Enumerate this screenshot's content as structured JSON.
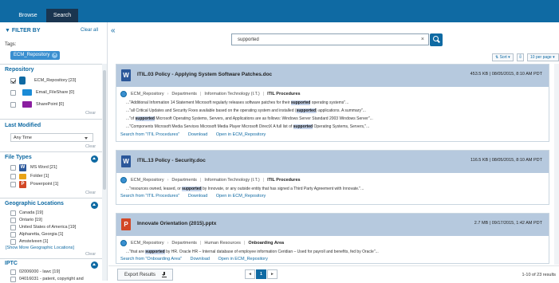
{
  "tabs": [
    {
      "label": "Browse"
    },
    {
      "label": "Search"
    }
  ],
  "sidebar": {
    "filter_by": "FILTER BY",
    "clear_all": "Clear all",
    "tags_label": "Tags:",
    "tag": "ECM_Repository",
    "repository": {
      "title": "Repository",
      "items": [
        {
          "label": "ECM_Repository [23]",
          "checked": true,
          "color": "#0f6aa3"
        },
        {
          "label": "Email_FileShare [0]",
          "checked": false,
          "color": "#1a8bd6"
        },
        {
          "label": "SharePoint [0]",
          "checked": false,
          "color": "#8b1ea0"
        }
      ],
      "clear": "Clear"
    },
    "last_modified": {
      "title": "Last Modified",
      "value": "Any Time",
      "clear": "Clear"
    },
    "file_types": {
      "title": "File Types",
      "items": [
        {
          "label": "MS Word [21]",
          "color": "#2b579a",
          "glyph": "W"
        },
        {
          "label": "Folder [1]",
          "color": "#e8a318",
          "glyph": ""
        },
        {
          "label": "Powerpoint [1]",
          "color": "#d24726",
          "glyph": "P"
        }
      ],
      "clear": "Clear"
    },
    "geo": {
      "title": "Geographic Locations",
      "items": [
        {
          "label": "Canada [19]"
        },
        {
          "label": "Ontario [19]"
        },
        {
          "label": "United States of America [19]"
        },
        {
          "label": "Alpharetta, Georgia [1]"
        },
        {
          "label": "Amstelveen [1]"
        }
      ],
      "more": "[Show More Geographic Locations]",
      "clear": "Clear"
    },
    "iptc": {
      "title": "IPTC",
      "items": [
        {
          "label": "02006000 - lawc [19]"
        },
        {
          "label": "04016031 - patent, copyright and"
        }
      ]
    }
  },
  "search": {
    "value": "supported",
    "clear_glyph": "×"
  },
  "toolbar": {
    "sort": "⇅ Sort ▾",
    "sort_dir": "⇩",
    "per_page": "10 per page ▾"
  },
  "results": [
    {
      "type_glyph": "W",
      "type_color": "#2b579a",
      "title": "ITIL.03 Policy - Applying System Software Patches.doc",
      "meta": "453.5 KB  |  08/05/2015, 8:10 AM PDT",
      "crumbs": [
        "ECM_Repository",
        "Departments",
        "Information Technology (I.T.)",
        "ITIL Procedures"
      ],
      "snippets": [
        [
          "...\"Additional Information 14 Statement Microsoft regularly releases software patches for their ",
          "supported",
          " operating systems\"..."
        ],
        [
          "...\"all Critical Updates and Security Fixes available based on the operating system and installed (",
          "supported",
          ") applications. A summary\"..."
        ],
        [
          "...\"of ",
          "supported",
          " Microsoft Operating Systems, Servers, and Applications are as follows: Windows Server Standard 2003 Windows Server\"..."
        ],
        [
          "...\"Components Microsoft Media Services Microsoft Media Player Microsoft DirectX A full list of ",
          "supported",
          " Operating Systems, Servers,\"..."
        ]
      ],
      "links": [
        "Search from \"ITIL Procedures\"",
        "Download",
        "Open in ECM_Repository"
      ]
    },
    {
      "type_glyph": "W",
      "type_color": "#2b579a",
      "title": "ITIL.13 Policy - Security.doc",
      "meta": "116.5 KB  |  08/05/2015, 8:10 AM PDT",
      "crumbs": [
        "ECM_Repository",
        "Departments",
        "Information Technology (I.T.)",
        "ITIL Procedures"
      ],
      "snippets": [
        [
          "...\"resources owned, leased, or ",
          "supported",
          " by Innovate, or any outside entity that has signed a Third Party Agreement with Innovate.\"..."
        ]
      ],
      "links": [
        "Search from \"ITIL Procedures\"",
        "Download",
        "Open in ECM_Repository"
      ]
    },
    {
      "type_glyph": "P",
      "type_color": "#d24726",
      "title": "Innovate Orientation (2015).pptx",
      "meta": "2.7 MB  |  09/17/2015, 1:42 AM PDT",
      "crumbs": [
        "ECM_Repository",
        "Departments",
        "Human Resources",
        "Onboarding Area"
      ],
      "snippets": [
        [
          "...\"that are ",
          "supported",
          " by HR. Oracle HR – Internal database of employee information Ceridian – Used for payroll and benefits, fed by Oracle\"..."
        ]
      ],
      "links": [
        "Search from \"Onboarding Area\"",
        "Download",
        "Open in ECM_Repository"
      ]
    }
  ],
  "footer": {
    "export": "Export Results",
    "prev": "◄",
    "page": "1",
    "next": "►",
    "count": "1-10 of 23 results"
  }
}
